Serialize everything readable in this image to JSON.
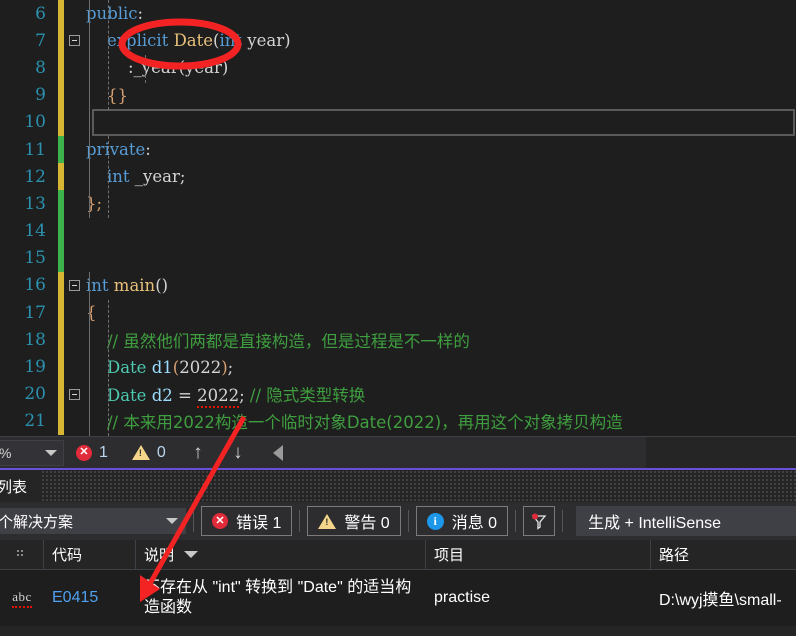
{
  "editor": {
    "first_line_number": 6,
    "lines": [
      {
        "num": "6",
        "track": "yellow",
        "fold": false,
        "text": "public:"
      },
      {
        "num": "7",
        "track": "yellow",
        "fold": true,
        "text": "    explicit Date(int year)"
      },
      {
        "num": "8",
        "track": "yellow",
        "fold": false,
        "text": "        :_year(year)"
      },
      {
        "num": "9",
        "track": "yellow",
        "fold": false,
        "text": "    {}"
      },
      {
        "num": "10",
        "track": "yellow",
        "fold": false,
        "text": ""
      },
      {
        "num": "11",
        "track": "green",
        "fold": false,
        "text": "private:"
      },
      {
        "num": "12",
        "track": "yellow",
        "fold": false,
        "text": "    int _year;"
      },
      {
        "num": "13",
        "track": "green",
        "fold": false,
        "text": "};"
      },
      {
        "num": "14",
        "track": "green",
        "fold": false,
        "text": ""
      },
      {
        "num": "15",
        "track": "green",
        "fold": false,
        "text": ""
      },
      {
        "num": "16",
        "track": "yellow",
        "fold": true,
        "text": "int main()"
      },
      {
        "num": "17",
        "track": "yellow",
        "fold": false,
        "text": "{"
      },
      {
        "num": "18",
        "track": "yellow",
        "fold": false,
        "text": "    // 虽然他们两都是直接构造，但是过程是不一样的"
      },
      {
        "num": "19",
        "track": "yellow",
        "fold": false,
        "text": "    Date d1(2022);"
      },
      {
        "num": "20",
        "track": "yellow",
        "fold": true,
        "text": "    Date d2 = 2022; // 隐式类型转换"
      },
      {
        "num": "21",
        "track": "yellow",
        "fold": false,
        "text": "    // 本来用2022构造一个临时对象Date(2022)，再用这个对象拷贝构造"
      }
    ],
    "tokens": {
      "public": "public",
      "colon": ":",
      "explicit": "explicit",
      "date_type": "Date",
      "paren_open": "(",
      "int_kw": "int",
      "year_param": "year",
      "paren_close": ")",
      "init_colon": ":",
      "member_year": "_year",
      "braces_empty": "{}",
      "private": "private",
      "member_decl": "int _year;",
      "class_close": "};",
      "int_main": "int",
      "main_name": "main",
      "main_parens": "()",
      "open_brace": "{",
      "comment18": "// 虽然他们两都是直接构造，但是过程是不一样的",
      "date_cls": "Date",
      "d1": "d1",
      "num2022": "2022",
      "semi": ";",
      "d2": "d2",
      "equals": "=",
      "comment20": "// 隐式类型转换",
      "comment21": "// 本来用2022构造一个临时对象Date(2022)，再用这个对象拷贝构造"
    }
  },
  "statusbar": {
    "zoom_value": "%",
    "error_count": "1",
    "warning_count": "0",
    "nav_up": "↑",
    "nav_down": "↓",
    "icons": {
      "error": "error-circle-icon",
      "warning": "warning-triangle-icon",
      "up": "arrow-up-icon",
      "down": "arrow-down-icon",
      "collapse": "triangle-left-icon"
    }
  },
  "toolwindow": {
    "tab_label": "误列表",
    "tab_label_full": "错误列表",
    "scope_filter": "个解决方案",
    "scope_filter_full": "整个解决方案",
    "errors_toggle": "错误 1",
    "warnings_toggle": "警告 0",
    "messages_toggle": "消息 0",
    "filter_icon_name": "funnel-filter-icon",
    "build_source": "生成 + IntelliSense"
  },
  "grid": {
    "columns": [
      {
        "key": "icon",
        "label": ""
      },
      {
        "key": "code",
        "label": "代码"
      },
      {
        "key": "description",
        "label": "说明",
        "sorted": true
      },
      {
        "key": "project",
        "label": "项目"
      },
      {
        "key": "path",
        "label": "路径"
      }
    ],
    "rows": [
      {
        "icon": "abc",
        "code": "E0415",
        "description": "不存在从 \"int\" 转换到 \"Date\" 的适当构造函数",
        "project": "practise",
        "path": "D:\\wyj摸鱼\\small-"
      }
    ]
  },
  "annotations": {
    "ellipse_target": "explicit",
    "arrow_color": "#f42323",
    "ellipse_color": "#f42323"
  },
  "colors": {
    "editor_bg": "#1e1e1e",
    "panel_bg": "#252526",
    "toolbar_bg": "#2d2d30",
    "line_number": "#2b91af",
    "keyword": "#569cd6",
    "type": "#e8c07a",
    "class": "#4ec9b0",
    "variable": "#9cdcfe",
    "comment": "#3f9e3f",
    "error_red": "#e02b3a",
    "warning_yellow": "#f5d58a",
    "info_blue": "#1c97ea",
    "link_blue": "#4ea1f0",
    "tab_accent": "#6a4fd8",
    "track_changed": "#d7b633",
    "track_saved": "#3cb44b"
  }
}
